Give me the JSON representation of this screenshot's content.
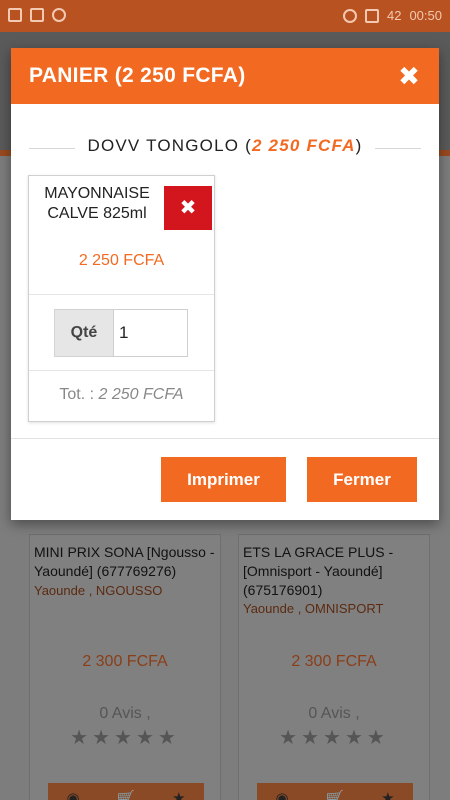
{
  "status_bar": {
    "battery": "42",
    "time": "00:50"
  },
  "modal": {
    "title": "PANIER (2 250 FCFA)",
    "close_icon": "close-icon",
    "shop": {
      "name": "DOVV TONGOLO",
      "total": "2 250 FCFA"
    },
    "item": {
      "name": "MAYONNAISE CALVE 825ml",
      "price": "2 250 FCFA",
      "qty_label": "Qté",
      "qty_value": "1",
      "total_label": "Tot. :",
      "total_value": "2 250 FCFA"
    },
    "buttons": {
      "print": "Imprimer",
      "close": "Fermer"
    }
  },
  "background_cards": [
    {
      "title": "MINI PRIX SONA [Ngousso - Yaoundé] (677769276)",
      "location": "Yaounde , NGOUSSO",
      "price": "2 300 FCFA",
      "reviews": "0 Avis ,"
    },
    {
      "title": "ETS LA GRACE PLUS - [Omnisport - Yaoundé] (675176901)",
      "location": "Yaounde , OMNISPORT",
      "price": "2 300 FCFA",
      "reviews": "0 Avis ,"
    }
  ],
  "colors": {
    "accent": "#f26a21",
    "danger": "#d3161e"
  }
}
